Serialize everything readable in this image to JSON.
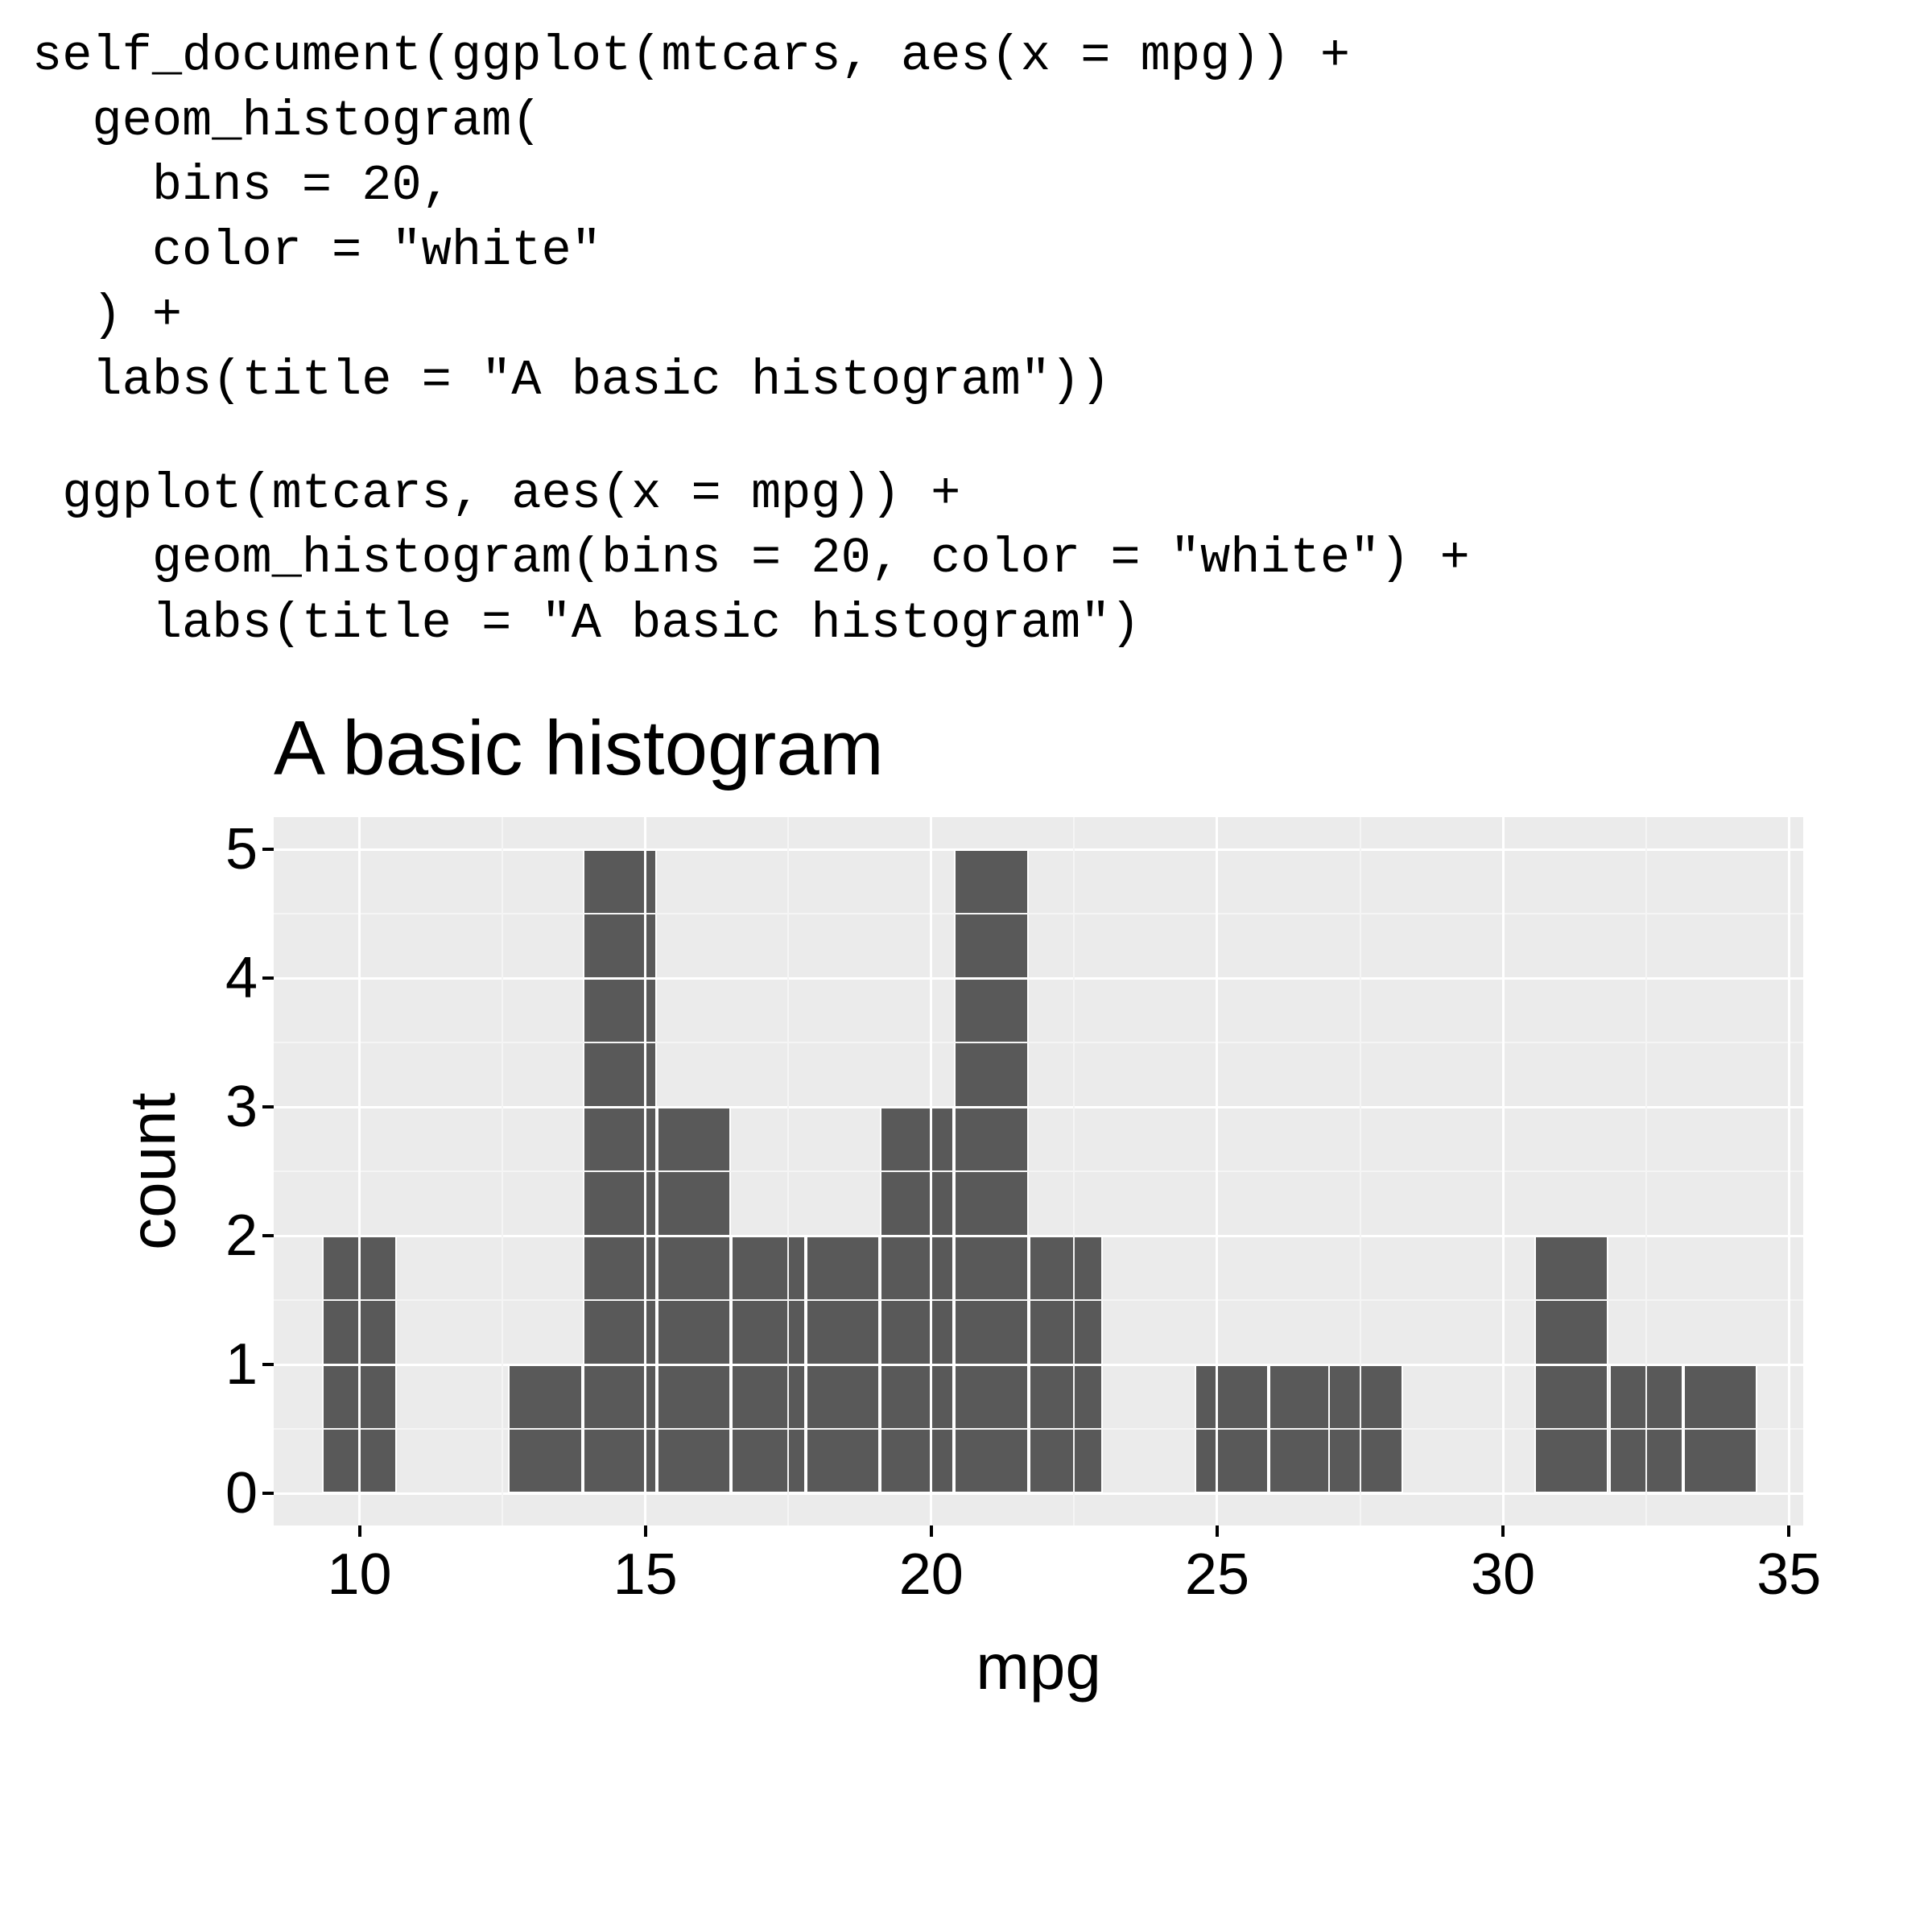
{
  "code_block_1": "self_document(ggplot(mtcars, aes(x = mpg)) +\n  geom_histogram(\n    bins = 20,\n    color = \"white\"\n  ) +\n  labs(title = \"A basic histogram\"))",
  "code_block_2": " ggplot(mtcars, aes(x = mpg)) + \n    geom_histogram(bins = 20, color = \"white\") + \n    labs(title = \"A basic histogram\")",
  "chart_data": {
    "type": "bar",
    "title": "A basic histogram",
    "xlabel": "mpg",
    "ylabel": "count",
    "xlim": [
      8.5,
      35.25
    ],
    "ylim": [
      -0.25,
      5.25
    ],
    "x_ticks": [
      10,
      15,
      20,
      25,
      30,
      35
    ],
    "y_ticks": [
      0,
      1,
      2,
      3,
      4,
      5
    ],
    "bin_width": 1.3,
    "bars": [
      {
        "x": 10.0,
        "count": 2
      },
      {
        "x": 13.25,
        "count": 1
      },
      {
        "x": 14.55,
        "count": 5
      },
      {
        "x": 15.85,
        "count": 3
      },
      {
        "x": 17.15,
        "count": 2
      },
      {
        "x": 18.45,
        "count": 2
      },
      {
        "x": 19.75,
        "count": 3
      },
      {
        "x": 21.05,
        "count": 5
      },
      {
        "x": 22.35,
        "count": 2
      },
      {
        "x": 25.25,
        "count": 1
      },
      {
        "x": 26.55,
        "count": 1
      },
      {
        "x": 27.6,
        "count": 1
      },
      {
        "x": 31.2,
        "count": 2
      },
      {
        "x": 32.5,
        "count": 1
      },
      {
        "x": 33.8,
        "count": 1
      }
    ]
  }
}
